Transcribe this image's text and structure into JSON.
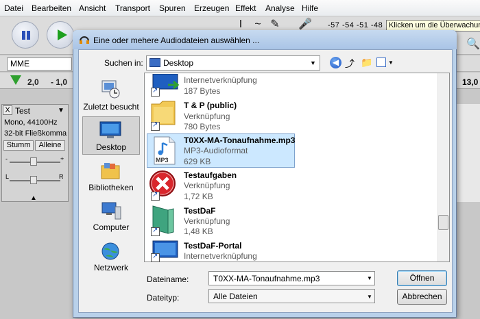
{
  "audacity": {
    "menu": [
      "Datei",
      "Bearbeiten",
      "Ansicht",
      "Transport",
      "Spuren",
      "Erzeugen",
      "Effekt",
      "Analyse",
      "Hilfe"
    ],
    "meter_scale": "-57 -54 -51 -48",
    "meter_tooltip": "Klicken um die Überwachung",
    "host": "MME",
    "ruler": [
      "2,0",
      "- 1,0",
      "13,0"
    ],
    "track": {
      "close": "X",
      "name": "Test",
      "rate": "Mono, 44100Hz",
      "format": "32-bit Fließkomma",
      "mute": "Stumm",
      "solo": "Alleine",
      "gain_minus": "-",
      "gain_plus": "+",
      "pan_left": "L",
      "pan_right": "R"
    }
  },
  "dialog": {
    "title": "Eine oder mehere Audiodateien auswählen ...",
    "look_in_label": "Suchen in:",
    "look_in_value": "Desktop",
    "places": [
      {
        "label": "Zuletzt besucht"
      },
      {
        "label": "Desktop"
      },
      {
        "label": "Bibliotheken"
      },
      {
        "label": "Computer"
      },
      {
        "label": "Netzwerk"
      }
    ],
    "files": [
      {
        "name": "",
        "type": "Internetverknüpfung",
        "size": "187 Bytes"
      },
      {
        "name": "T & P (public)",
        "type": "Verknüpfung",
        "size": "780 Bytes"
      },
      {
        "name": "T0XX-MA-Tonaufnahme.mp3",
        "type": "MP3-Audioformat",
        "size": "629 KB",
        "selected": true
      },
      {
        "name": "Testaufgaben",
        "type": "Verknüpfung",
        "size": "1,72 KB"
      },
      {
        "name": "TestDaF",
        "type": "Verknüpfung",
        "size": "1,48 KB"
      },
      {
        "name": "TestDaF-Portal",
        "type": "Internetverknüpfung",
        "size": ""
      }
    ],
    "filename_label": "Dateiname:",
    "filename_value": "T0XX-MA-Tonaufnahme.mp3",
    "filetype_label": "Dateityp:",
    "filetype_value": "Alle Dateien",
    "open_label": "Öffnen",
    "cancel_label": "Abbrechen",
    "mp3_badge": "MP3"
  }
}
